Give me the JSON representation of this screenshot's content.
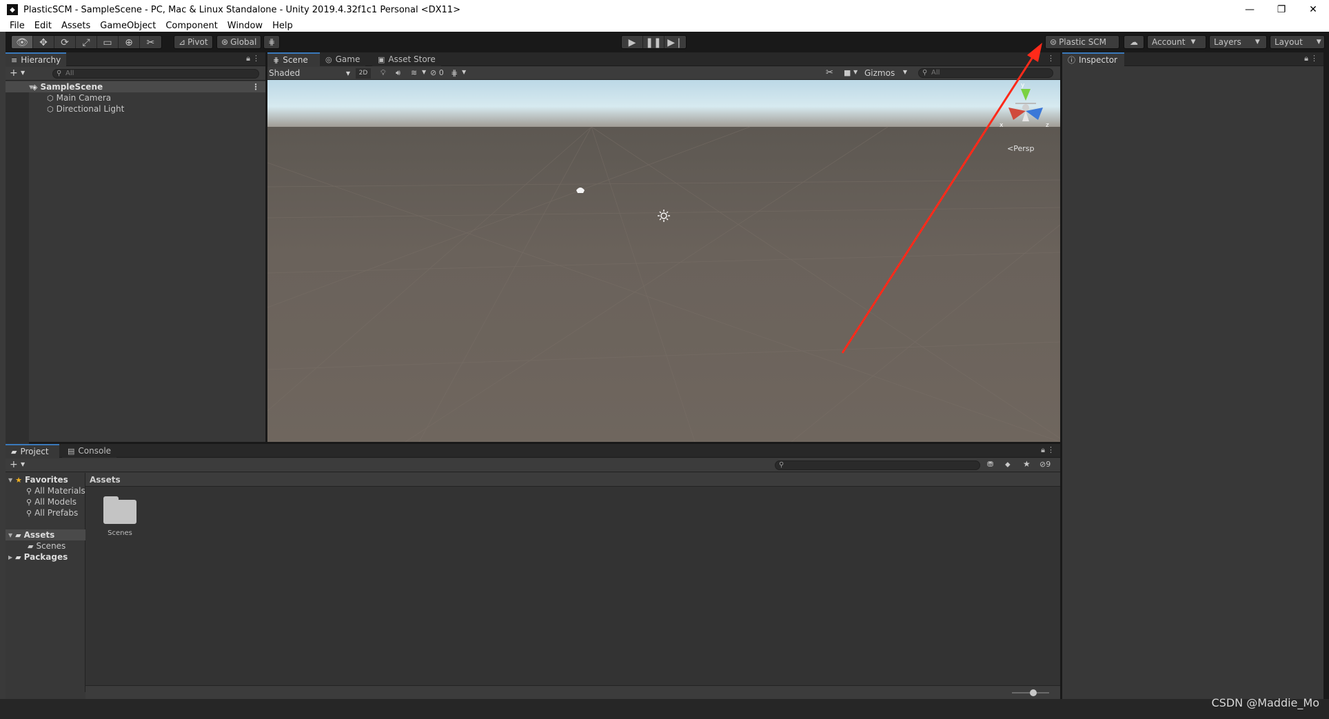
{
  "window": {
    "title": "PlasticSCM - SampleScene - PC, Mac & Linux Standalone - Unity 2019.4.32f1c1 Personal <DX11>",
    "controls": [
      "—",
      "❐",
      "✕"
    ]
  },
  "menu": [
    "File",
    "Edit",
    "Assets",
    "GameObject",
    "Component",
    "Window",
    "Help"
  ],
  "toolbar": {
    "pivot_label": "Pivot",
    "global_label": "Global",
    "plastic_label": "Plastic SCM",
    "account_label": "Account",
    "layers_label": "Layers",
    "layout_label": "Layout"
  },
  "hierarchy": {
    "tab_label": "Hierarchy",
    "search_placeholder": "All",
    "scene_name": "SampleScene",
    "items": [
      "Main Camera",
      "Directional Light"
    ]
  },
  "scene_view": {
    "tabs": [
      "Scene",
      "Game",
      "Asset Store"
    ],
    "shading_mode": "Shaded",
    "toggle_2d": "2D",
    "hidden_count": "0",
    "gizmos_label": "Gizmos",
    "search_placeholder": "All",
    "persp_label": "Persp",
    "axis_labels": {
      "x": "x",
      "y": "y",
      "z": "z"
    }
  },
  "inspector": {
    "tab_label": "Inspector"
  },
  "project": {
    "tabs": [
      "Project",
      "Console"
    ],
    "favorites_label": "Favorites",
    "favorites": [
      "All Materials",
      "All Models",
      "All Prefabs"
    ],
    "assets_label": "Assets",
    "asset_children": [
      "Scenes"
    ],
    "packages_label": "Packages",
    "breadcrumb": "Assets",
    "folders": [
      "Scenes"
    ],
    "hidden_count": "9"
  },
  "watermark": "CSDN @Maddie_Mo",
  "colors": {
    "accent": "#3a79bb",
    "annotation_arrow": "#ff2a1a"
  }
}
